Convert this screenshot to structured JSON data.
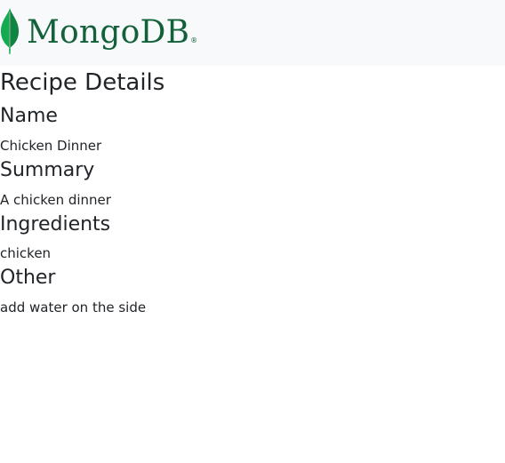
{
  "navbar": {
    "brand": "MongoDB",
    "brand_mark": "®",
    "leaf_icon": "mongodb-leaf-icon",
    "colors": {
      "background": "#f8f9fa",
      "brand_green": "#13613a",
      "leaf_green": "#13aa52"
    }
  },
  "page": {
    "title": "Recipe Details"
  },
  "sections": {
    "name": {
      "heading": "Name",
      "value": "Chicken Dinner"
    },
    "summary": {
      "heading": "Summary",
      "value": "A chicken dinner"
    },
    "ingredients": {
      "heading": "Ingredients",
      "value": "chicken"
    },
    "other": {
      "heading": "Other",
      "value": "add water on the side"
    }
  }
}
